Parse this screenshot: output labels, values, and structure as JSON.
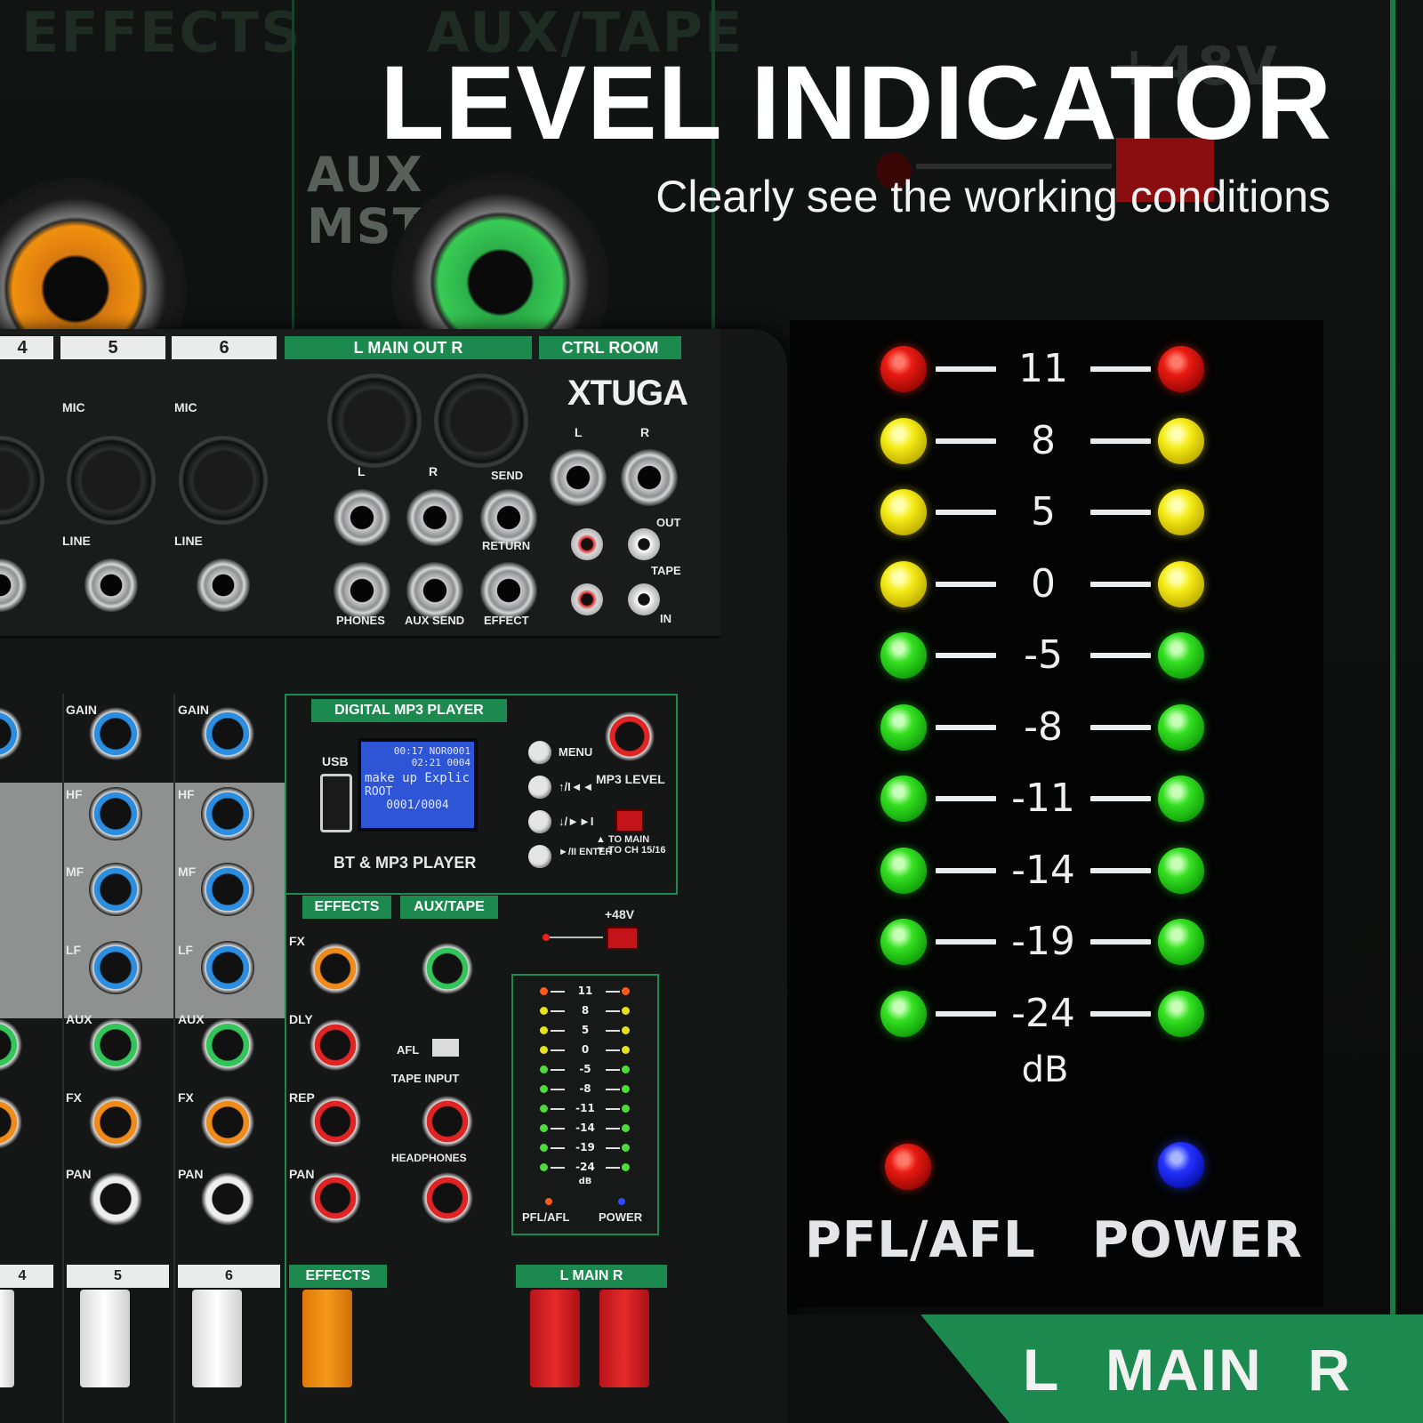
{
  "headline": {
    "title": "LEVEL INDICATOR",
    "subtitle": "Clearly see the working conditions"
  },
  "background_labels": {
    "effects": "EFFECTS",
    "aux_tape": "AUX/TAPE",
    "aux_mst": "AUX\nMST",
    "phantom": "+48V"
  },
  "mixer": {
    "brand": "XTUGA",
    "channel_tabs": [
      "4",
      "5",
      "6"
    ],
    "top_sections": [
      "L MAIN OUT R",
      "CTRL ROOM"
    ],
    "jack_labels": [
      "MIC",
      "LINE",
      "L",
      "R",
      "SEND",
      "RETURN",
      "PHONES",
      "AUX SEND",
      "EFFECT",
      "OUT",
      "TAPE",
      "IN"
    ],
    "player": {
      "title": "DIGITAL MP3 PLAYER",
      "usb": "USB",
      "caption": "BT & MP3 PLAYER",
      "lcd_lines": [
        "00:17  NOR0001",
        "02:21  0004",
        "make up Explic",
        "ROOT",
        "0001/0004"
      ],
      "buttons": [
        "MENU",
        "↑/I◄◄",
        "↓/►►I",
        "►/II ENTER"
      ],
      "level": "MP3 LEVEL",
      "routing": "▲ TO MAIN\n▼ TO CH 15/16"
    },
    "strip_labels": [
      "GAIN",
      "HF",
      "MF",
      "LF",
      "AUX",
      "FX",
      "PAN"
    ],
    "fx_labels": [
      "FX",
      "DLY",
      "REP",
      "PAN"
    ],
    "sections": [
      "EFFECTS",
      "AUX/TAPE",
      "TAPE INPUT",
      "HEADPHONES",
      "AFL",
      "+48V"
    ],
    "mini_meter": {
      "marks": [
        "11",
        "8",
        "5",
        "0",
        "-5",
        "-8",
        "-11",
        "-14",
        "-19",
        "-24"
      ],
      "unit": "dB",
      "pfl": "PFL/AFL",
      "power": "POWER"
    },
    "bottom_tabs": [
      "4",
      "5",
      "6",
      "EFFECTS",
      "L MAIN R"
    ]
  },
  "meter": {
    "rows": [
      {
        "value": "11",
        "color": "red"
      },
      {
        "value": "8",
        "color": "yellow"
      },
      {
        "value": "5",
        "color": "yellow"
      },
      {
        "value": "0",
        "color": "yellow"
      },
      {
        "value": "-5",
        "color": "green"
      },
      {
        "value": "-8",
        "color": "green"
      },
      {
        "value": "-11",
        "color": "green"
      },
      {
        "value": "-14",
        "color": "green"
      },
      {
        "value": "-19",
        "color": "green"
      },
      {
        "value": "-24",
        "color": "green"
      }
    ],
    "unit": "dB",
    "pfl_label": "PFL/AFL",
    "power_label": "POWER",
    "pfl_color": "red",
    "power_color": "blue"
  },
  "main_label": {
    "left": "L",
    "center": "MAIN",
    "right": "R"
  },
  "colors": {
    "accent_green": "#1c8a4f",
    "background": "#0b0d0c"
  }
}
